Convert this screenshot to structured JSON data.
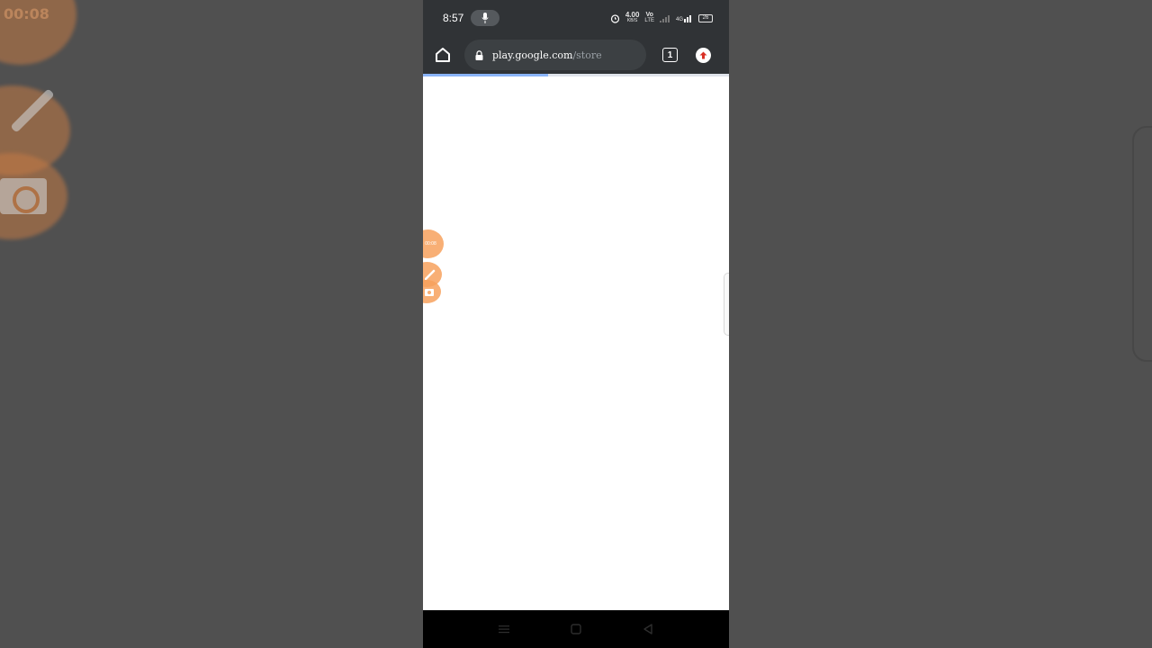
{
  "status_bar": {
    "time": "8:57",
    "net_speed": "4.00",
    "net_speed_unit": "KB/S",
    "volte_top": "Vo",
    "volte_bottom": "LTE",
    "network_type": "4G",
    "battery": "26"
  },
  "browser": {
    "url_domain": "play.google.com",
    "url_path": "/store",
    "tab_count": "1",
    "load_progress": 0.41
  },
  "overlay": {
    "timer_text": "00:08"
  },
  "colors": {
    "toolbar_bg": "#303336",
    "progress": "#8ab4f8",
    "recorder_orange": "#f7a25d",
    "extension_red": "#d93025"
  }
}
